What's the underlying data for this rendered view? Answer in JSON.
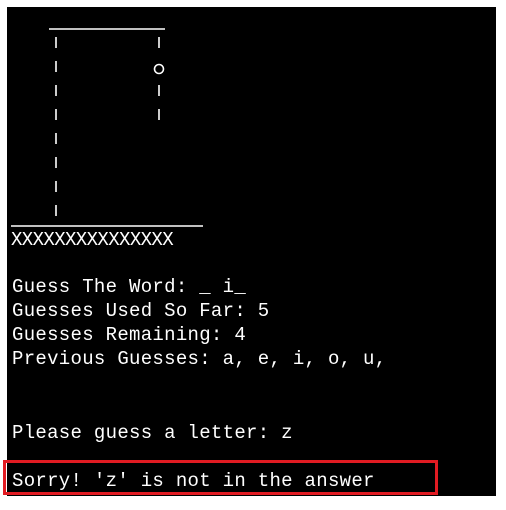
{
  "terminal": {
    "gallows_row": "XXXXXXXXXXXXXXX",
    "lines": {
      "guess_word": "Guess The Word: _ i_",
      "guesses_used": "Guesses Used So Far: 5",
      "guesses_remaining": "Guesses Remaining: 4",
      "previous_guesses": "Previous Guesses: a, e, i, o, u,",
      "prompt": "Please guess a letter: z",
      "feedback": "Sorry! 'z' is not in the answer"
    }
  },
  "colors": {
    "terminal_background": "#000000",
    "text": "#ffffff",
    "highlight_border": "#e11b22"
  }
}
